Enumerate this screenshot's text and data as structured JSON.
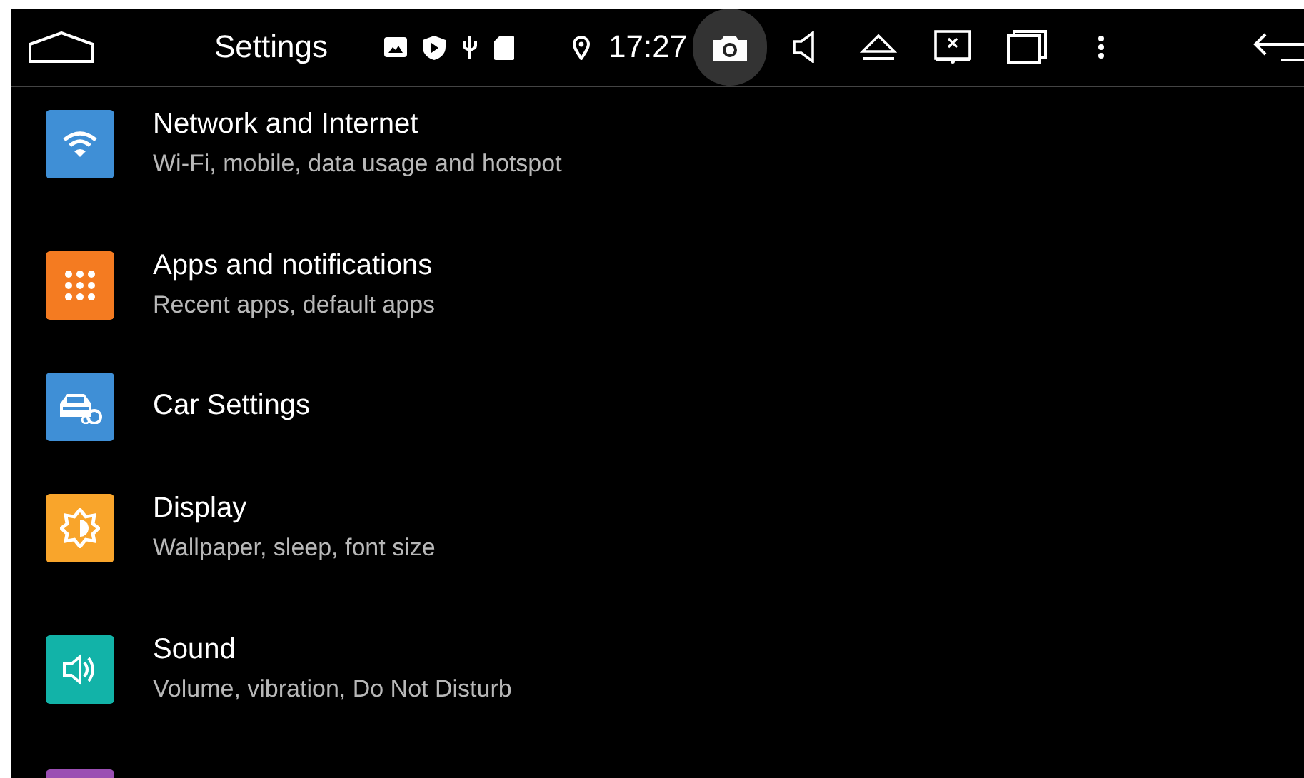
{
  "top_bar": {
    "title": "Settings",
    "time": "17:27",
    "status_icons": [
      {
        "kind": "image"
      },
      {
        "kind": "shield-play"
      },
      {
        "kind": "usb"
      },
      {
        "kind": "sd-card"
      },
      {
        "kind": "location"
      }
    ],
    "buttons": [
      {
        "kind": "camera",
        "pressed": true
      },
      {
        "kind": "volume",
        "pressed": false
      },
      {
        "kind": "eject",
        "pressed": false
      },
      {
        "kind": "screen-off",
        "pressed": false
      },
      {
        "kind": "windows",
        "pressed": false
      },
      {
        "kind": "more",
        "pressed": false
      }
    ]
  },
  "settings": [
    {
      "kind": "wifi",
      "color": "#3f8fd6",
      "title": "Network and Internet",
      "subtitle": "Wi-Fi, mobile, data usage and hotspot"
    },
    {
      "kind": "apps",
      "color": "#f47b21",
      "title": "Apps and notifications",
      "subtitle": "Recent apps, default apps"
    },
    {
      "kind": "car",
      "color": "#3f8fd6",
      "title": "Car Settings"
    },
    {
      "kind": "display",
      "color": "#f9a52b",
      "title": "Display",
      "subtitle": "Wallpaper, sleep, font size"
    },
    {
      "kind": "sound",
      "color": "#12b3a8",
      "title": "Sound",
      "subtitle": "Volume, vibration, Do Not Disturb"
    },
    {
      "kind": "partial",
      "color": "#9b4fb3"
    }
  ]
}
